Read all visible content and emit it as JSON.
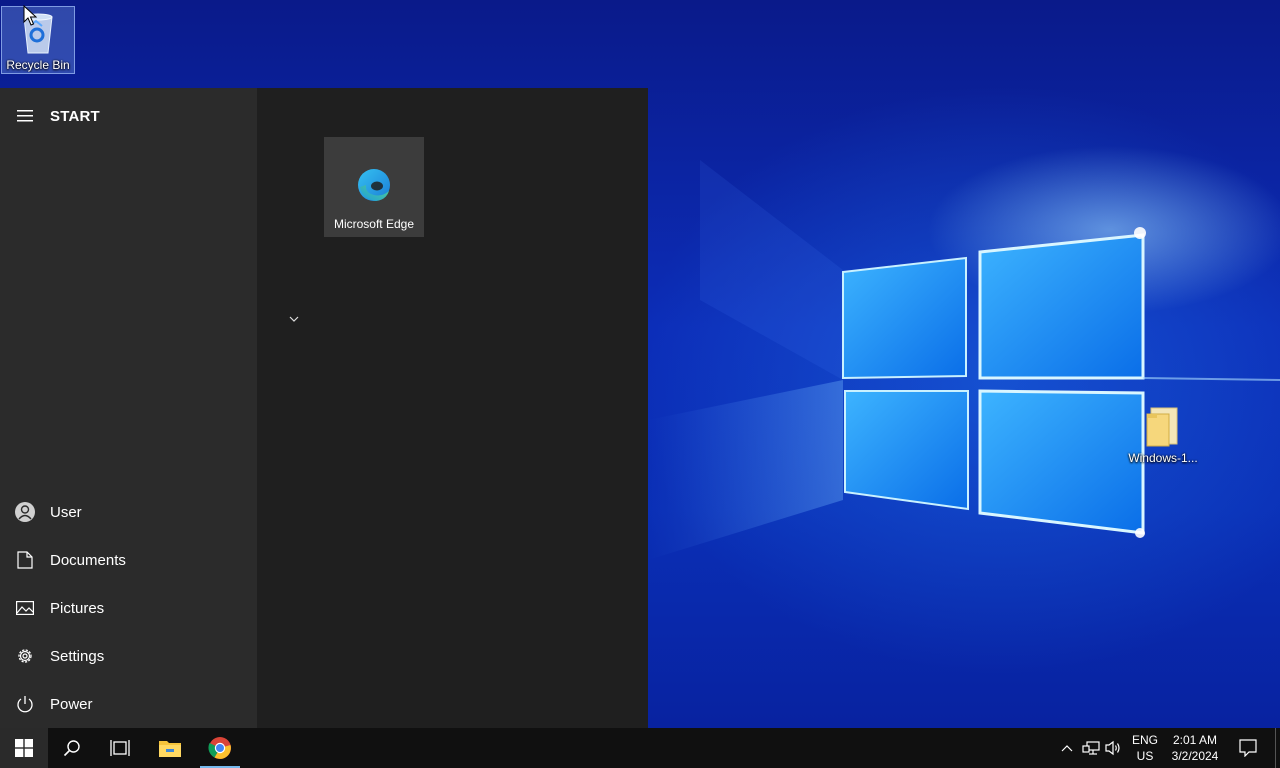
{
  "desktop": {
    "icons": [
      {
        "label": "Recycle Bin",
        "icon": "recycle-bin-icon"
      },
      {
        "label": "Windows-1...",
        "icon": "folder-icon"
      }
    ]
  },
  "start_menu": {
    "title": "START",
    "sidebar": [
      {
        "label": "User",
        "icon": "user-icon"
      },
      {
        "label": "Documents",
        "icon": "document-icon"
      },
      {
        "label": "Pictures",
        "icon": "picture-icon"
      },
      {
        "label": "Settings",
        "icon": "gear-icon"
      },
      {
        "label": "Power",
        "icon": "power-icon"
      }
    ],
    "tiles": [
      {
        "label": "Microsoft Edge",
        "icon": "edge-icon"
      }
    ]
  },
  "taskbar": {
    "apps": [
      {
        "name": "windows-start",
        "icon": "windows-logo-icon"
      },
      {
        "name": "search",
        "icon": "search-icon"
      },
      {
        "name": "task-view",
        "icon": "task-view-icon"
      },
      {
        "name": "file-explorer",
        "icon": "folder-icon"
      },
      {
        "name": "chrome",
        "icon": "chrome-icon",
        "active": true
      }
    ],
    "tray": {
      "lang_top": "ENG",
      "lang_bottom": "US",
      "time": "2:01 AM",
      "date": "3/2/2024"
    }
  },
  "colors": {
    "menu_left": "#2b2b2b",
    "menu_right": "#1f1f1f",
    "taskbar": "#101010",
    "accent": "#76b9ed"
  }
}
